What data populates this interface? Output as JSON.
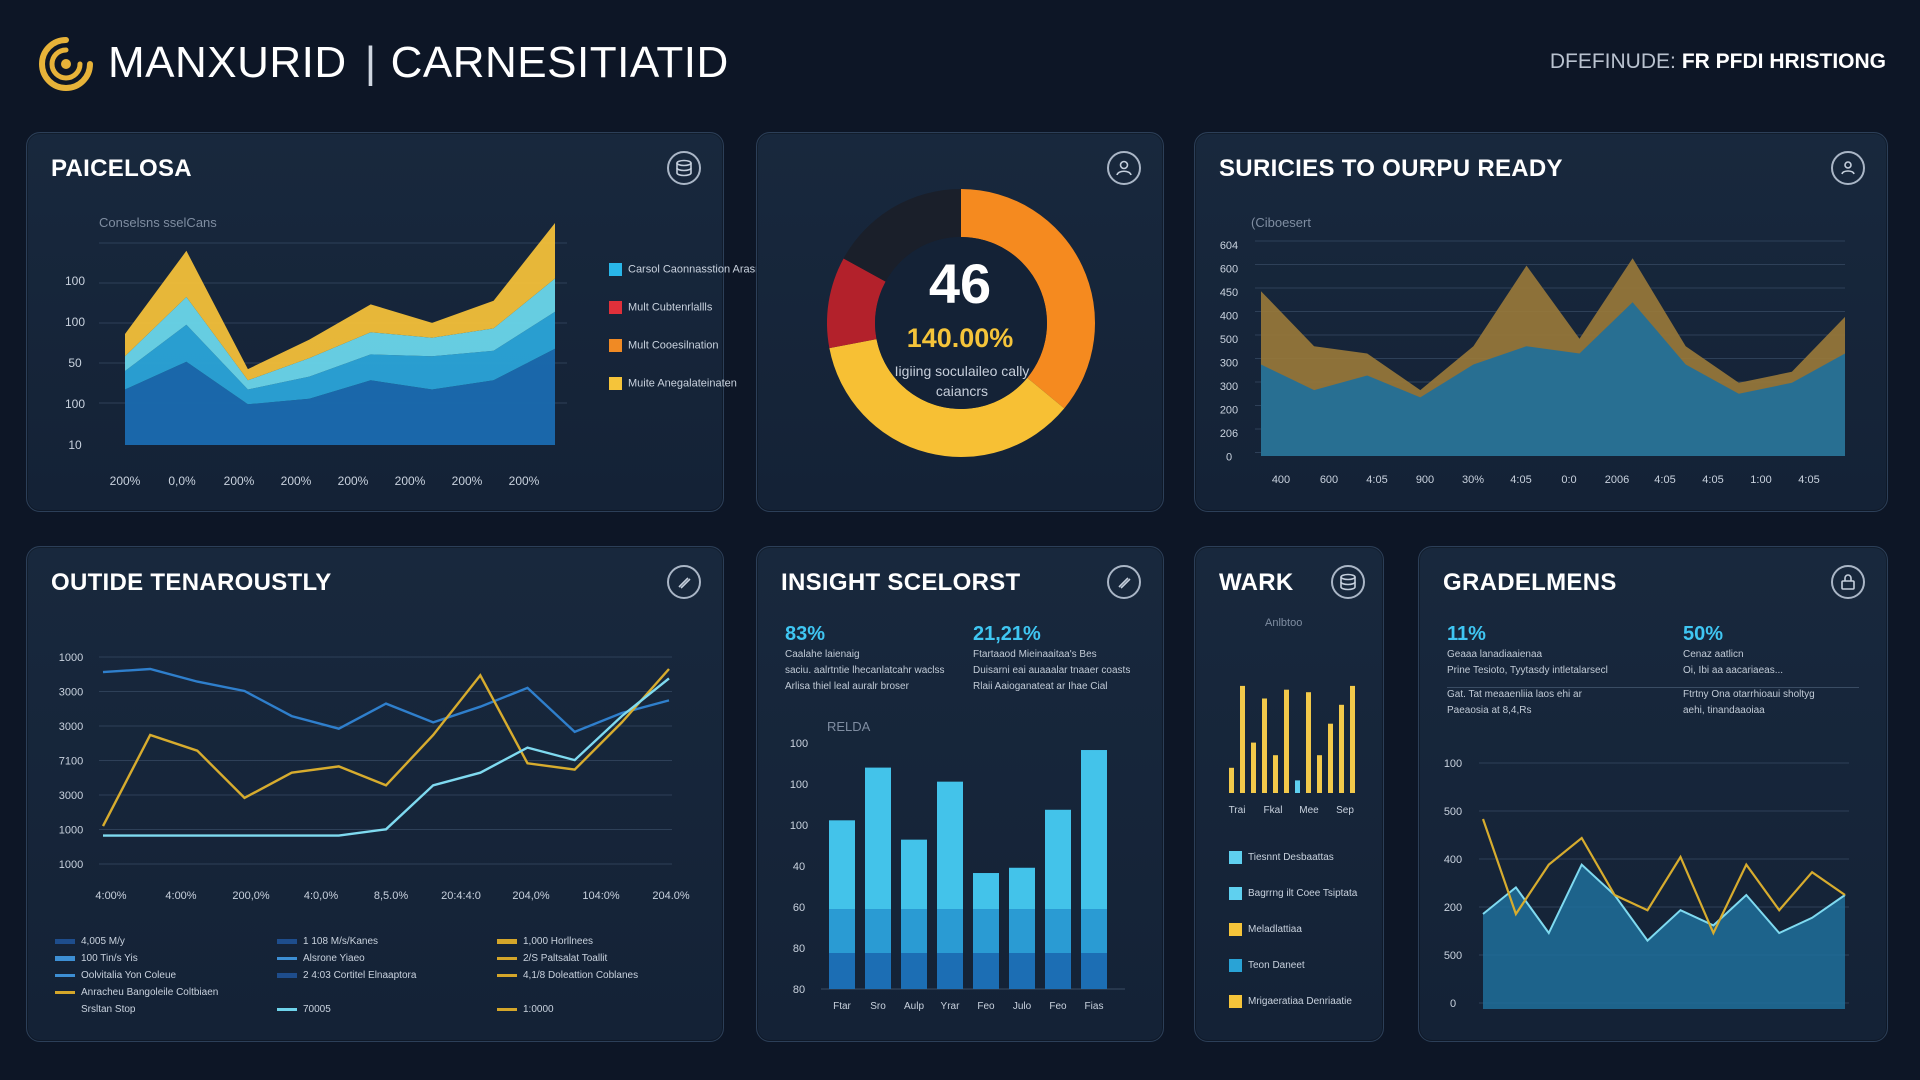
{
  "header": {
    "brand_part1": "MANXURID",
    "brand_part2": "CARNESITIATID",
    "right_key": "DFEFINUDE:",
    "right_value": "FR PFDI HRISTIONG"
  },
  "panels": {
    "paicelosa": {
      "title": "PAICELOSA",
      "subtitle": "Conselsns sselCans",
      "y_ticks": [
        "100",
        "100",
        "50",
        "100",
        "10"
      ],
      "x_ticks": [
        "200%",
        "0,0%",
        "200%",
        "200%",
        "200%",
        "200%",
        "200%",
        "200%"
      ],
      "legend": [
        {
          "label": "Carsol Caonnasstion Arasneaaiation",
          "color": "#29b6e8"
        },
        {
          "label": "Mult Cubtenrlallls",
          "color": "#e0303a"
        },
        {
          "label": "Mult Cooesilnation",
          "color": "#f08a24"
        },
        {
          "label": "Muite Anegalateinaten",
          "color": "#f5c43a"
        }
      ]
    },
    "gauge": {
      "value": "46",
      "percent": "140.00%",
      "caption": "Iigiing soculaileo cally caiancrs",
      "segments": [
        {
          "name": "orange",
          "fraction": 0.36,
          "color": "#f58a1f"
        },
        {
          "name": "yellow",
          "fraction": 0.36,
          "color": "#f7c034"
        },
        {
          "name": "red",
          "fraction": 0.11,
          "color": "#b3212b"
        },
        {
          "name": "dark",
          "fraction": 0.17,
          "color": "#1a1f2a"
        }
      ]
    },
    "suricies": {
      "title": "SURICIES TO OURPU READY",
      "subtitle": "(Ciboesert",
      "y_ticks": [
        "604",
        "600",
        "450",
        "400",
        "500",
        "300",
        "300",
        "200",
        "206",
        "0"
      ],
      "x_ticks": [
        "400",
        "600",
        "4:05",
        "900",
        "30%",
        "4:05",
        "0:0",
        "2006",
        "4:05",
        "4:05",
        "1:00",
        "4:05"
      ]
    },
    "outide": {
      "title": "OUTIDE TENAROUSTLY",
      "y_ticks": [
        "1000",
        "3000",
        "3000",
        "7100",
        "3000",
        "1000",
        "1000"
      ],
      "x_ticks": [
        "4:00%",
        "4:00%",
        "200,0%",
        "4:0,0%",
        "8,5.0%",
        "20:4:4:0",
        "204,0%",
        "104:0%",
        "204.0%"
      ],
      "legend": [
        {
          "label": "4,005 M/y",
          "color": "#1e4d8c",
          "type": "bar"
        },
        {
          "label": "100 Tin/s Yis",
          "color": "#3d8fd4",
          "type": "bar"
        },
        {
          "label": "Oolvitalia Yon Coleue",
          "color": "#3d8fd4",
          "type": "line"
        },
        {
          "label": "Anracheu Bangoleile Coltbiaen",
          "color": "#d4a62a",
          "type": "line"
        },
        {
          "label": "Srsltan Stop",
          "color": "#d4a62a",
          "type": "none"
        },
        {
          "label": "1 108 M/s/Kanes",
          "color": "#1e4d8c",
          "type": "bar"
        },
        {
          "label": "Alsrone Yiaeo",
          "color": "#3d8fd4",
          "type": "line"
        },
        {
          "label": "2 4:03 Cortitel Elnaaptora",
          "color": "#1e4d8c",
          "type": "bar"
        },
        {
          "label": "70005",
          "color": "#6fd3ea",
          "type": "line"
        },
        {
          "label": "1,000 Horllnees",
          "color": "#d4a62a",
          "type": "bar"
        },
        {
          "label": "2/S Paltsalat Toallit",
          "color": "#d4a62a",
          "type": "line"
        },
        {
          "label": "4,1/8 Doleattion Coblanes",
          "color": "#d4a62a",
          "type": "line"
        },
        {
          "label": "1:0000",
          "color": "#d4a62a",
          "type": "line"
        }
      ]
    },
    "insight": {
      "title": "INSIGHT SCELORST",
      "stat1": "83%",
      "stat1_desc": [
        "Caalahe laienaig",
        "saciu. aalrtntie lhecanlatcahr waclss",
        "Arlisa thiel leal auralr broser"
      ],
      "stat2": "21,21%",
      "stat2_desc": [
        "Ftartaaod Mieinaaitaa's Bes",
        "Duisarni eai auaaalar tnaaer coasts",
        "Rlaii Aaioganateat ar Ihae Cial"
      ],
      "chart_label": "RELDA",
      "y_ticks": [
        "100",
        "100",
        "100",
        "40",
        "60",
        "80",
        "80"
      ],
      "x_ticks": [
        "Ftar",
        "Sro",
        "Aulp",
        "Yrar",
        "Feo",
        "Julo",
        "Feo",
        "Fias"
      ]
    },
    "wark": {
      "title": "WARK",
      "subtitle": "Anlbtoo",
      "x_ticks": [
        "Trai",
        "Fkal",
        "Mee",
        "Sep"
      ],
      "legend": [
        {
          "label": "Tiesnnt Desbaattas",
          "color": "#5fd0ef"
        },
        {
          "label": "Bagrrng ilt Coee Tsiptata",
          "color": "#5fd0ef"
        },
        {
          "label": "Meladlattiaa",
          "color": "#f5c43a"
        },
        {
          "label": "Teon Daneet",
          "color": "#29a3d6"
        },
        {
          "label": "Mrigaeratiaa Denriaatie",
          "color": "#f5c43a"
        }
      ]
    },
    "gradelmens": {
      "title": "GRADELMENS",
      "stat1": "11%",
      "stat1_desc": [
        "Geaaa lanadiaaienaa",
        "Prine Tesioto, Tyytasdy intletalarsecl",
        "Gat. Tat meaaenliia laos ehi ar",
        "Paeaosia at 8,4,Rs"
      ],
      "stat2": "50%",
      "stat2_desc": [
        "Cenaz aatlicn",
        "Oi, Ibi aa aacariaeas...",
        "Ftrtny Ona otarrhioaui sholtyg",
        "aehi, tinandaaoiaa"
      ],
      "y_ticks": [
        "100",
        "500",
        "400",
        "200",
        "500",
        "0"
      ]
    }
  },
  "chart_data": [
    {
      "type": "area",
      "title": "PAICELOSA",
      "categories": [
        "200%",
        "0,0%",
        "200%",
        "200%",
        "200%",
        "200%",
        "200%",
        "200%"
      ],
      "series": [
        {
          "name": "Carsol Caonnasstion Arasneaaiation",
          "values": [
            30,
            45,
            22,
            25,
            35,
            30,
            35,
            52
          ]
        },
        {
          "name": "Mult Cubtenrlallls",
          "values": [
            10,
            20,
            8,
            12,
            14,
            18,
            16,
            20
          ]
        },
        {
          "name": "Mult Cooesilnation",
          "values": [
            8,
            15,
            5,
            10,
            12,
            10,
            12,
            18
          ]
        },
        {
          "name": "Muite Anegalateinaten",
          "values": [
            12,
            25,
            6,
            10,
            15,
            8,
            15,
            30
          ]
        }
      ]
    },
    {
      "type": "pie",
      "title": "",
      "categories": [
        "orange",
        "yellow",
        "red",
        "dark"
      ],
      "values": [
        36,
        36,
        11,
        17
      ]
    },
    {
      "type": "area",
      "title": "SURICIES TO OURPU READY",
      "x": [
        "400",
        "600",
        "4:05",
        "900",
        "30%",
        "4:05",
        "0:0",
        "2006",
        "4:05",
        "4:05",
        "1:00",
        "4:05"
      ],
      "series": [
        {
          "name": "blue",
          "values": [
            250,
            180,
            220,
            160,
            250,
            300,
            280,
            420,
            250,
            170,
            200,
            280
          ]
        },
        {
          "name": "gold",
          "values": [
            450,
            300,
            280,
            180,
            300,
            520,
            320,
            540,
            300,
            200,
            230,
            380
          ]
        }
      ]
    },
    {
      "type": "line",
      "title": "OUTIDE TENAROUSTLY",
      "series": [
        {
          "name": "blue",
          "values": [
            6200,
            6300,
            5900,
            5600,
            4800,
            4400,
            5200,
            4600,
            5100,
            5700,
            4300,
            4900,
            5300
          ]
        },
        {
          "name": "gold",
          "values": [
            1300,
            4200,
            3700,
            2200,
            3000,
            3200,
            2600,
            4200,
            6100,
            3300,
            3100,
            4600,
            6300
          ]
        },
        {
          "name": "light",
          "values": [
            1000,
            1000,
            1000,
            1000,
            1000,
            1000,
            1200,
            2600,
            3000,
            3800,
            3400,
            4800,
            6000
          ]
        }
      ]
    },
    {
      "type": "bar",
      "title": "INSIGHT SCELORST",
      "categories": [
        "Ftar",
        "Sro",
        "Aulp",
        "Yrar",
        "Feo",
        "Julo",
        "Feo",
        "Fias"
      ],
      "values": [
        96,
        126,
        85,
        118,
        66,
        69,
        102,
        136
      ]
    },
    {
      "type": "bar",
      "title": "WARK",
      "values": [
        20,
        85,
        40,
        75,
        30,
        82,
        10,
        80,
        30,
        55,
        70,
        85
      ]
    },
    {
      "type": "area",
      "title": "GRADELMENS",
      "series": [
        {
          "name": "area",
          "values": [
            250,
            320,
            200,
            380,
            300,
            180,
            260,
            220,
            300,
            200,
            240,
            300
          ]
        },
        {
          "name": "gold",
          "values": [
            500,
            250,
            380,
            450,
            300,
            260,
            400,
            200,
            380,
            260,
            360,
            300
          ]
        }
      ]
    }
  ]
}
